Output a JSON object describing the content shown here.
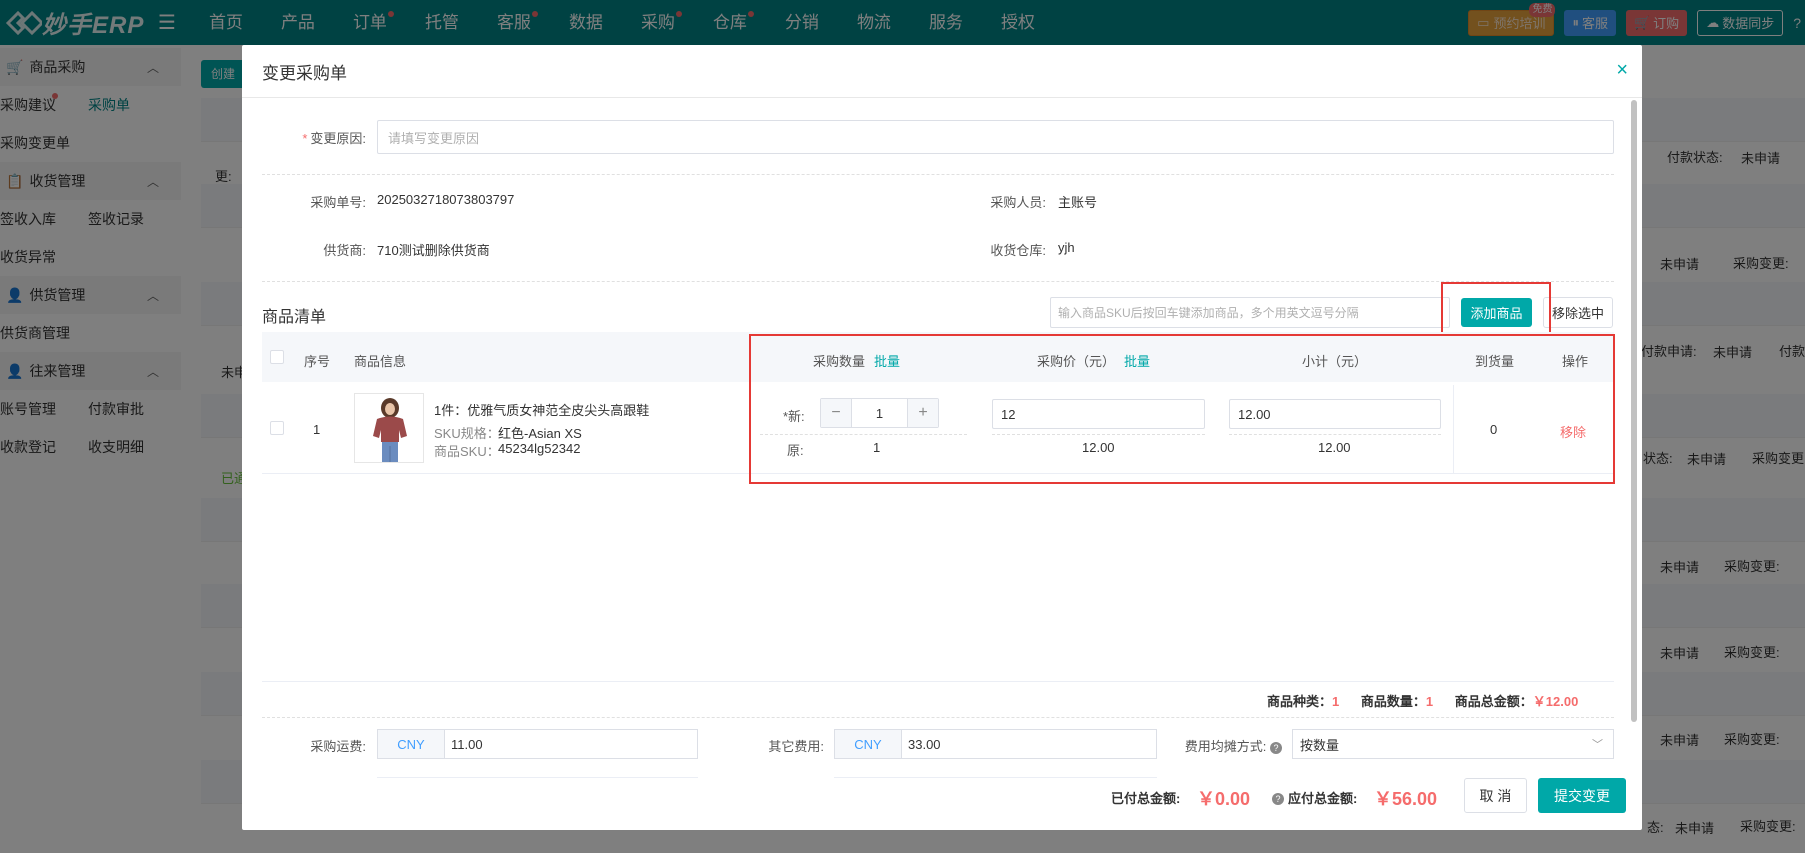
{
  "topbar": {
    "logo_text": "妙手ERP",
    "nav": [
      {
        "label": "首页",
        "dot": false
      },
      {
        "label": "产品",
        "dot": false
      },
      {
        "label": "订单",
        "dot": true
      },
      {
        "label": "托管",
        "dot": false
      },
      {
        "label": "客服",
        "dot": true
      },
      {
        "label": "数据",
        "dot": false
      },
      {
        "label": "采购",
        "dot": true
      },
      {
        "label": "仓库",
        "dot": true
      },
      {
        "label": "分销",
        "dot": false
      },
      {
        "label": "物流",
        "dot": false
      },
      {
        "label": "服务",
        "dot": false
      },
      {
        "label": "授权",
        "dot": false
      }
    ],
    "training_label": "预约培训",
    "training_badge": "免费",
    "service_label": "客服",
    "order_label": "订购",
    "sync_label": "数据同步",
    "help_icon": "?"
  },
  "sidebar": {
    "groups": [
      {
        "label": "商品采购",
        "items": [
          "采购建议",
          "采购单",
          "采购变更单"
        ]
      },
      {
        "label": "收货管理",
        "items": [
          "签收入库",
          "签收记录",
          "收货异常"
        ]
      },
      {
        "label": "供货管理",
        "items": [
          "供货商管理"
        ]
      },
      {
        "label": "往来管理",
        "items": [
          "账号管理",
          "付款审批",
          "收款登记",
          "收支明细"
        ]
      }
    ]
  },
  "background": {
    "create_label": "创建",
    "texts": {
      "pay_status_1": "付款状态:",
      "not_applied_1": "未申请",
      "row1_prefix": "更:",
      "not_applied_2": "未申请",
      "purchase_change_2": "采购变更:",
      "pay_apply_3": "付款申请:",
      "not_applied_3": "未申请",
      "pay_3": "付款",
      "row3_prefix": "未申",
      "status_4": "状态:",
      "not_applied_4": "未申请",
      "purchase_change_4": "采购变更",
      "row4_prefix": "已通",
      "not_applied_5": "未申请",
      "purchase_change_5": "采购变更:",
      "not_applied_6": "未申请",
      "purchase_change_6": "采购变更:",
      "not_applied_7": "未申请",
      "purchase_change_7": "采购变更:",
      "status_8": "态:",
      "not_applied_8": "未申请",
      "purchase_change_8": "采购变更:"
    }
  },
  "modal": {
    "title": "变更采购单",
    "close_icon": "×",
    "reason_label": "变更原因:",
    "reason_placeholder": "请填写变更原因",
    "order_no_label": "采购单号:",
    "order_no": "2025032718073803797",
    "buyer_label": "采购人员:",
    "buyer": "主账号",
    "supplier_label": "供货商:",
    "supplier": "710测试删除供货商",
    "warehouse_label": "收货仓库:",
    "warehouse": "yjh",
    "product_list_title": "商品清单",
    "sku_placeholder": "输入商品SKU后按回车键添加商品，多个用英文逗号分隔",
    "add_product_label": "添加商品",
    "remove_selected_label": "移除选中",
    "table": {
      "headers": {
        "index": "序号",
        "info": "商品信息",
        "qty": "采购数量",
        "qty_batch": "批量",
        "price": "采购价（元）",
        "price_batch": "批量",
        "subtotal": "小计（元）",
        "arrived": "到货量",
        "action": "操作"
      },
      "rows": [
        {
          "index": "1",
          "name": "1件：优雅气质女神范全皮尖头高跟鞋",
          "spec_label": "SKU规格：",
          "spec": "红色-Asian XS",
          "sku_label": "商品SKU：",
          "sku": "45234lg52342",
          "new_label": "*新:",
          "new_qty": "1",
          "orig_label": "原:",
          "orig_qty": "1",
          "price_input": "12",
          "orig_price": "12.00",
          "subtotal_input": "12.00",
          "orig_subtotal": "12.00",
          "arrived": "0",
          "remove_label": "移除"
        }
      ]
    },
    "summary": {
      "kinds_label": "商品种类：",
      "kinds": "1",
      "qty_label": "商品数量：",
      "qty": "1",
      "total_label": "商品总金额：",
      "total": "￥12.00"
    },
    "freight_label": "采购运费:",
    "freight_currency": "CNY",
    "freight_value": "11.00",
    "other_label": "其它费用:",
    "other_currency": "CNY",
    "other_value": "33.00",
    "allocation_label": "费用均摊方式:",
    "allocation_value": "按数量",
    "paid_label": "已付总金额:",
    "paid_value": "￥0.00",
    "payable_label": "应付总金额:",
    "payable_value": "￥56.00",
    "cancel_label": "取 消",
    "submit_label": "提交变更"
  }
}
